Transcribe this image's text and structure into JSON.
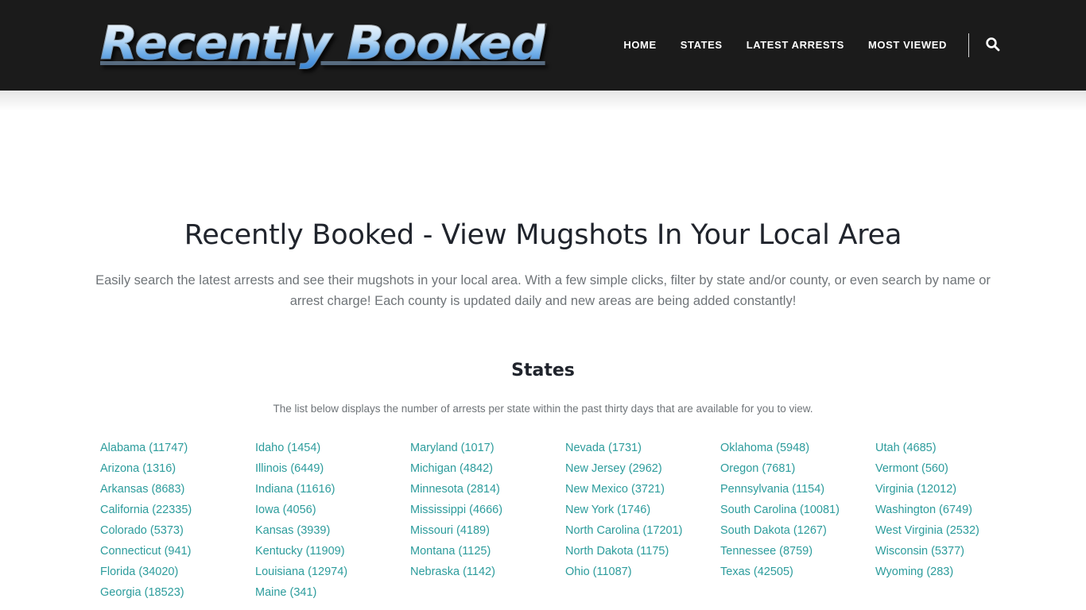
{
  "site": {
    "logo_text": "Recently Booked",
    "background_color": "#1b1b1b",
    "link_color": "#2c9c9c",
    "heading_color": "#20242c",
    "muted_text_color": "#6f7478"
  },
  "nav": {
    "items": [
      {
        "label": "HOME",
        "name": "nav-home"
      },
      {
        "label": "STATES",
        "name": "nav-states"
      },
      {
        "label": "LATEST ARRESTS",
        "name": "nav-latest-arrests"
      },
      {
        "label": "MOST VIEWED",
        "name": "nav-most-viewed"
      }
    ],
    "search_icon": "search-icon"
  },
  "hero": {
    "title": "Recently Booked - View Mugshots In Your Local Area",
    "description": "Easily search the latest arrests and see their mugshots in your local area. With a few simple clicks, filter by state and/or county, or even search by name or arrest charge! Each county is updated daily and new areas are being added constantly!"
  },
  "states_section": {
    "title": "States",
    "description": "The list below displays the number of arrests per state within the past thirty days that are available for you to view.",
    "columns": [
      [
        {
          "label": "Alabama (11747)",
          "state": "Alabama",
          "count": 11747
        },
        {
          "label": "Arizona (1316)",
          "state": "Arizona",
          "count": 1316
        },
        {
          "label": "Arkansas (8683)",
          "state": "Arkansas",
          "count": 8683
        },
        {
          "label": "California (22335)",
          "state": "California",
          "count": 22335
        },
        {
          "label": "Colorado (5373)",
          "state": "Colorado",
          "count": 5373
        },
        {
          "label": "Connecticut (941)",
          "state": "Connecticut",
          "count": 941
        },
        {
          "label": "Florida (34020)",
          "state": "Florida",
          "count": 34020
        },
        {
          "label": "Georgia (18523)",
          "state": "Georgia",
          "count": 18523
        }
      ],
      [
        {
          "label": "Idaho (1454)",
          "state": "Idaho",
          "count": 1454
        },
        {
          "label": "Illinois (6449)",
          "state": "Illinois",
          "count": 6449
        },
        {
          "label": "Indiana (11616)",
          "state": "Indiana",
          "count": 11616
        },
        {
          "label": "Iowa (4056)",
          "state": "Iowa",
          "count": 4056
        },
        {
          "label": "Kansas (3939)",
          "state": "Kansas",
          "count": 3939
        },
        {
          "label": "Kentucky (11909)",
          "state": "Kentucky",
          "count": 11909
        },
        {
          "label": "Louisiana (12974)",
          "state": "Louisiana",
          "count": 12974
        },
        {
          "label": "Maine (341)",
          "state": "Maine",
          "count": 341
        }
      ],
      [
        {
          "label": "Maryland (1017)",
          "state": "Maryland",
          "count": 1017
        },
        {
          "label": "Michigan (4842)",
          "state": "Michigan",
          "count": 4842
        },
        {
          "label": "Minnesota (2814)",
          "state": "Minnesota",
          "count": 2814
        },
        {
          "label": "Mississippi (4666)",
          "state": "Mississippi",
          "count": 4666
        },
        {
          "label": "Missouri (4189)",
          "state": "Missouri",
          "count": 4189
        },
        {
          "label": "Montana (1125)",
          "state": "Montana",
          "count": 1125
        },
        {
          "label": "Nebraska (1142)",
          "state": "Nebraska",
          "count": 1142
        }
      ],
      [
        {
          "label": "Nevada (1731)",
          "state": "Nevada",
          "count": 1731
        },
        {
          "label": "New Jersey (2962)",
          "state": "New Jersey",
          "count": 2962
        },
        {
          "label": "New Mexico (3721)",
          "state": "New Mexico",
          "count": 3721
        },
        {
          "label": "New York (1746)",
          "state": "New York",
          "count": 1746
        },
        {
          "label": "North Carolina (17201)",
          "state": "North Carolina",
          "count": 17201
        },
        {
          "label": "North Dakota (1175)",
          "state": "North Dakota",
          "count": 1175
        },
        {
          "label": "Ohio (11087)",
          "state": "Ohio",
          "count": 11087
        }
      ],
      [
        {
          "label": "Oklahoma (5948)",
          "state": "Oklahoma",
          "count": 5948
        },
        {
          "label": "Oregon (7681)",
          "state": "Oregon",
          "count": 7681
        },
        {
          "label": "Pennsylvania (1154)",
          "state": "Pennsylvania",
          "count": 1154
        },
        {
          "label": "South Carolina (10081)",
          "state": "South Carolina",
          "count": 10081
        },
        {
          "label": "South Dakota (1267)",
          "state": "South Dakota",
          "count": 1267
        },
        {
          "label": "Tennessee (8759)",
          "state": "Tennessee",
          "count": 8759
        },
        {
          "label": "Texas (42505)",
          "state": "Texas",
          "count": 42505
        }
      ],
      [
        {
          "label": "Utah (4685)",
          "state": "Utah",
          "count": 4685
        },
        {
          "label": "Vermont (560)",
          "state": "Vermont",
          "count": 560
        },
        {
          "label": "Virginia (12012)",
          "state": "Virginia",
          "count": 12012
        },
        {
          "label": "Washington (6749)",
          "state": "Washington",
          "count": 6749
        },
        {
          "label": "West Virginia (2532)",
          "state": "West Virginia",
          "count": 2532
        },
        {
          "label": "Wisconsin (5377)",
          "state": "Wisconsin",
          "count": 5377
        },
        {
          "label": "Wyoming (283)",
          "state": "Wyoming",
          "count": 283
        }
      ]
    ]
  }
}
